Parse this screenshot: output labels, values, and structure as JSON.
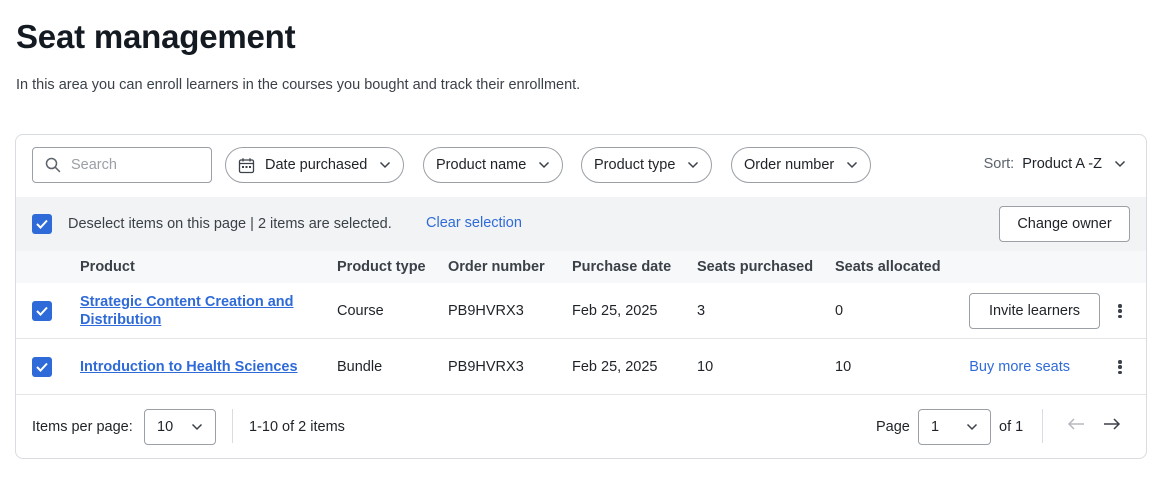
{
  "header": {
    "title": "Seat management",
    "description": "In this area you can enroll learners in the courses you bought and track their enrollment."
  },
  "filters": {
    "search_placeholder": "Search",
    "date_purchased": "Date purchased",
    "product_name": "Product name",
    "product_type": "Product type",
    "order_number": "Order number",
    "sort_label": "Sort:",
    "sort_value": "Product A -Z"
  },
  "selection": {
    "text": "Deselect items on this page | 2 items are selected.",
    "clear_label": "Clear selection",
    "change_owner_label": "Change owner"
  },
  "table": {
    "columns": [
      "Product",
      "Product type",
      "Order number",
      "Purchase date",
      "Seats purchased",
      "Seats allocated"
    ],
    "rows": [
      {
        "product_line1": "Strategic Content Creation and",
        "product_line2": "Distribution",
        "type": "Course",
        "order": "PB9HVRX3",
        "date": "Feb 25, 2025",
        "purchased": "3",
        "allocated": "0",
        "action": "Invite learners",
        "checked": true
      },
      {
        "product_line1": "Introduction to Health Sciences",
        "type": "Bundle",
        "order": "PB9HVRX3",
        "date": "Feb 25, 2025",
        "purchased": "10",
        "allocated": "10",
        "action": "Buy more seats",
        "checked": true
      }
    ]
  },
  "pagination": {
    "items_per_page_label": "Items per page:",
    "items_per_page_value": "10",
    "range_text": "1-10 of 2 items",
    "page_label": "Page",
    "page_value": "1",
    "of_text": "of 1"
  },
  "colors": {
    "accent": "#2f6bd8",
    "selection_bar": "#f1f3f5",
    "border": "#9aa0a6"
  }
}
